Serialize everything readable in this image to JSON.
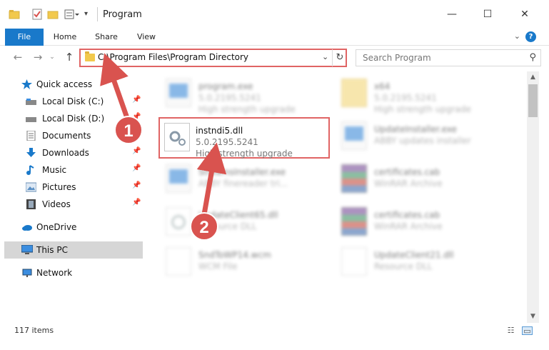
{
  "window": {
    "title": "Program",
    "controls": {
      "minimize": "—",
      "maximize": "☐",
      "close": "✕"
    }
  },
  "ribbon": {
    "tabs": [
      "File",
      "Home",
      "Share",
      "View"
    ],
    "help": "?"
  },
  "address_bar": {
    "path": "C:\\Program Files\\Program Directory",
    "search_placeholder": "Search Program"
  },
  "sidebar": {
    "items": [
      {
        "label": "Quick access",
        "icon": "star-icon",
        "pinned": false
      },
      {
        "label": "Local Disk (C:)",
        "icon": "drive-icon",
        "pinned": true
      },
      {
        "label": "Local Disk (D:)",
        "icon": "drive-icon",
        "pinned": true
      },
      {
        "label": "Documents",
        "icon": "documents-icon",
        "pinned": true
      },
      {
        "label": "Downloads",
        "icon": "download-icon",
        "pinned": true
      },
      {
        "label": "Music",
        "icon": "music-icon",
        "pinned": true
      },
      {
        "label": "Pictures",
        "icon": "pictures-icon",
        "pinned": true
      },
      {
        "label": "Videos",
        "icon": "videos-icon",
        "pinned": true
      },
      {
        "label": "OneDrive",
        "icon": "cloud-icon",
        "pinned": false
      },
      {
        "label": "This PC",
        "icon": "computer-icon",
        "pinned": false,
        "selected": true
      },
      {
        "label": "Network",
        "icon": "network-icon",
        "pinned": false
      }
    ]
  },
  "files": [
    {
      "name": "program.exe",
      "line1": "5.0.2195.5241",
      "line2": "High strength upgrade",
      "icon": "exe-icon"
    },
    {
      "name": "x64",
      "line1": "5.0.2195.5241",
      "line2": "High strength upgrade",
      "icon": "folder-icon"
    },
    {
      "name": "instndi5.dll",
      "line1": "5.0.2195.5241",
      "line2": "High strength upgrade",
      "icon": "dll-gear-icon",
      "highlighted": true
    },
    {
      "name": "UpdateInstaller.exe",
      "line1": "ABBY updates installer",
      "line2": "",
      "icon": "exe-icon"
    },
    {
      "name": "StreamsInstaller.exe",
      "line1": "ABBY finereader tri...",
      "line2": "",
      "icon": "exe-icon"
    },
    {
      "name": "certificates.cab",
      "line1": "WinRAR Archive",
      "line2": "",
      "icon": "archive-icon"
    },
    {
      "name": "UpdateClient65.dll",
      "line1": "Resource DLL",
      "line2": "",
      "icon": "dll-gear-icon"
    },
    {
      "name": "certificates.cab",
      "line1": "WinRAR Archive",
      "line2": "",
      "icon": "archive-icon"
    },
    {
      "name": "SndToWP14.wcm",
      "line1": "WCM File",
      "line2": "",
      "icon": "document-icon"
    },
    {
      "name": "UpdateClient21.dll",
      "line1": "Resource DLL",
      "line2": "",
      "icon": "document-icon"
    }
  ],
  "status": {
    "item_count": "117 items"
  },
  "annotations": {
    "step1": "1",
    "step2": "2",
    "color": "#d9534f"
  },
  "colors": {
    "accent": "#1979ca",
    "highlight_border": "#e06464"
  }
}
